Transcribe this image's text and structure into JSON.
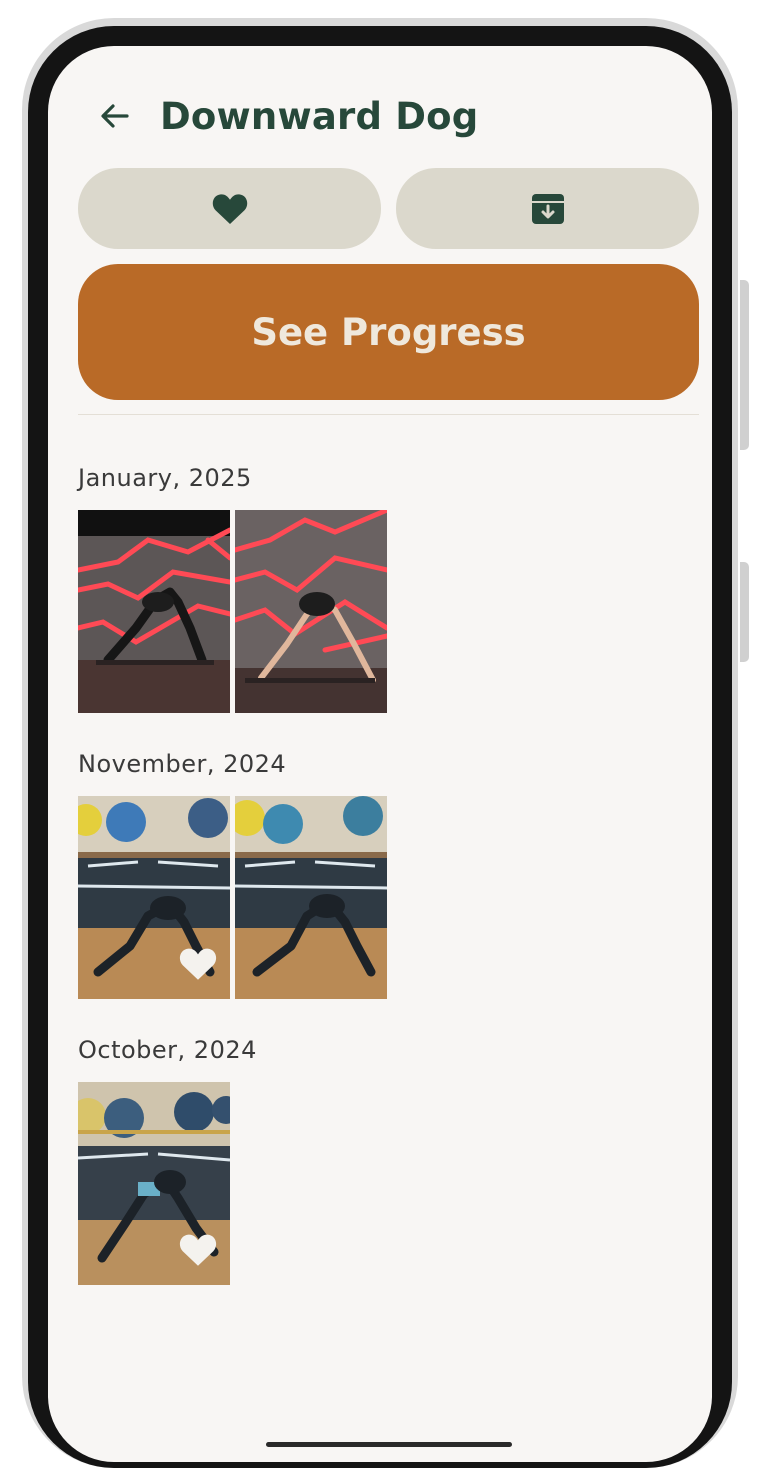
{
  "header": {
    "title": "Downward Dog",
    "back_icon": "arrow-left-icon"
  },
  "actions": {
    "favorite_icon": "heart-icon",
    "archive_icon": "archive-box-icon",
    "see_progress_label": "See Progress"
  },
  "colors": {
    "title": "#27483a",
    "pill_bg": "#dbd8cc",
    "cta_bg": "#b96a27",
    "cta_text": "#efe8dc",
    "screen_bg": "#f8f6f4"
  },
  "sections": [
    {
      "label": "January, 2025",
      "photos": [
        {
          "favorited": false
        },
        {
          "favorited": false
        }
      ]
    },
    {
      "label": "November, 2024",
      "photos": [
        {
          "favorited": true
        },
        {
          "favorited": false
        }
      ]
    },
    {
      "label": "October, 2024",
      "photos": [
        {
          "favorited": true
        }
      ]
    }
  ]
}
